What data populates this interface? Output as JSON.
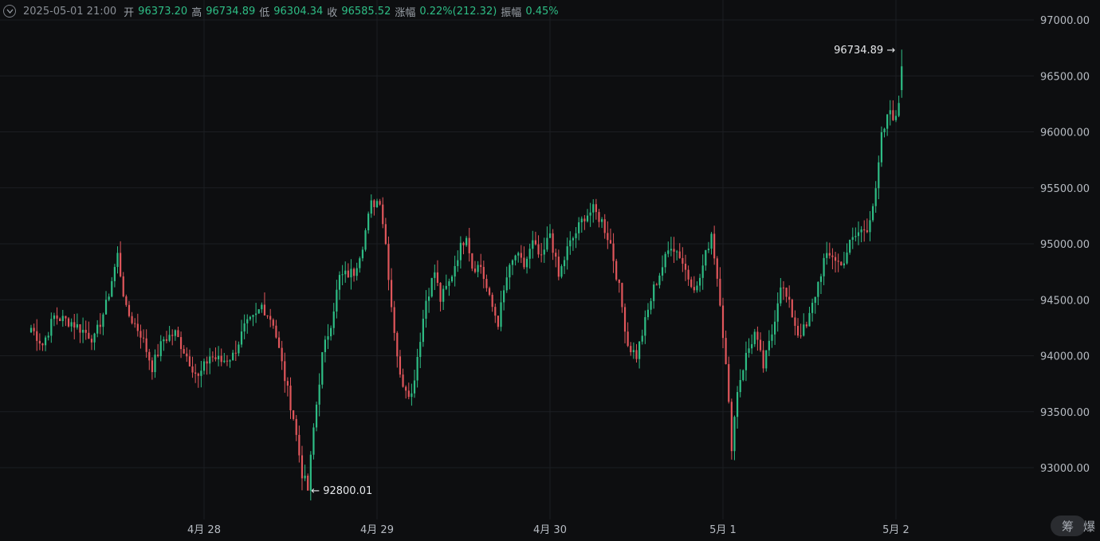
{
  "info_bar": {
    "datetime": "2025-05-01 21:00",
    "open_label": "开",
    "open_value": "96373.20",
    "high_label": "高",
    "high_value": "96734.89",
    "low_label": "低",
    "low_value": "96304.34",
    "close_label": "收",
    "close_value": "96585.52",
    "change_label": "涨幅",
    "change_value": "0.22%(212.32)",
    "amplitude_label": "振幅",
    "amplitude_value": "0.45%"
  },
  "colors": {
    "background": "#0d0e10",
    "up": "#2ebd85",
    "down": "#e0565b",
    "grid": "#1c1e22",
    "axis_text": "#b7bcc3"
  },
  "icons": {
    "collapse": "chevron-down-icon"
  },
  "corner_badge": {
    "chars": [
      "筹",
      "爆"
    ]
  },
  "chart_data": {
    "type": "candlestick",
    "y_ticks": [
      93000,
      93500,
      94000,
      94500,
      95000,
      95500,
      96000,
      96500,
      97000
    ],
    "y_tick_labels": [
      "93000.00",
      "93500.00",
      "94000.00",
      "94500.00",
      "95000.00",
      "95500.00",
      "96000.00",
      "96500.00",
      "97000.00"
    ],
    "x_ticks": [
      {
        "label": "4月 28",
        "candle_index": 60
      },
      {
        "label": "4月 29",
        "candle_index": 120
      },
      {
        "label": "4月 30",
        "candle_index": 180
      },
      {
        "label": "5月 1",
        "candle_index": 240
      },
      {
        "label": "5月 2",
        "candle_index": 300
      }
    ],
    "candles_per_day": 60,
    "annotations": {
      "max_label": "96734.89",
      "min_label": "92800.01"
    },
    "waypoints": [
      [
        0,
        94250
      ],
      [
        4,
        94100
      ],
      [
        8,
        94350
      ],
      [
        14,
        94300
      ],
      [
        22,
        94150
      ],
      [
        26,
        94450
      ],
      [
        30,
        94900
      ],
      [
        33,
        94400
      ],
      [
        38,
        94200
      ],
      [
        42,
        93900
      ],
      [
        46,
        94150
      ],
      [
        50,
        94200
      ],
      [
        54,
        94000
      ],
      [
        58,
        93800
      ],
      [
        62,
        94000
      ],
      [
        66,
        93950
      ],
      [
        70,
        94000
      ],
      [
        74,
        94250
      ],
      [
        78,
        94350
      ],
      [
        80,
        94450
      ],
      [
        84,
        94300
      ],
      [
        88,
        93800
      ],
      [
        91,
        93450
      ],
      [
        94,
        92950
      ],
      [
        96,
        92800
      ],
      [
        98,
        93350
      ],
      [
        101,
        94000
      ],
      [
        104,
        94300
      ],
      [
        107,
        94700
      ],
      [
        112,
        94750
      ],
      [
        115,
        95000
      ],
      [
        118,
        95350
      ],
      [
        121,
        95400
      ],
      [
        123,
        95000
      ],
      [
        125,
        94450
      ],
      [
        128,
        93800
      ],
      [
        132,
        93650
      ],
      [
        134,
        94000
      ],
      [
        137,
        94500
      ],
      [
        140,
        94750
      ],
      [
        142,
        94500
      ],
      [
        145,
        94650
      ],
      [
        148,
        94900
      ],
      [
        151,
        95100
      ],
      [
        153,
        94800
      ],
      [
        156,
        94800
      ],
      [
        159,
        94500
      ],
      [
        162,
        94300
      ],
      [
        165,
        94700
      ],
      [
        168,
        94900
      ],
      [
        171,
        94800
      ],
      [
        174,
        95000
      ],
      [
        177,
        94850
      ],
      [
        180,
        95100
      ],
      [
        183,
        94700
      ],
      [
        186,
        94950
      ],
      [
        189,
        95100
      ],
      [
        192,
        95250
      ],
      [
        195,
        95300
      ],
      [
        198,
        95200
      ],
      [
        201,
        95000
      ],
      [
        204,
        94600
      ],
      [
        207,
        94100
      ],
      [
        210,
        94000
      ],
      [
        213,
        94300
      ],
      [
        216,
        94600
      ],
      [
        219,
        94800
      ],
      [
        222,
        95000
      ],
      [
        225,
        94900
      ],
      [
        228,
        94700
      ],
      [
        231,
        94600
      ],
      [
        234,
        94900
      ],
      [
        236,
        95100
      ],
      [
        239,
        94500
      ],
      [
        241,
        93900
      ],
      [
        243,
        93200
      ],
      [
        245,
        93700
      ],
      [
        248,
        94000
      ],
      [
        251,
        94200
      ],
      [
        254,
        93900
      ],
      [
        257,
        94200
      ],
      [
        260,
        94650
      ],
      [
        263,
        94450
      ],
      [
        266,
        94200
      ],
      [
        269,
        94250
      ],
      [
        272,
        94550
      ],
      [
        275,
        94850
      ],
      [
        278,
        94900
      ],
      [
        281,
        94800
      ],
      [
        284,
        95000
      ],
      [
        287,
        95100
      ],
      [
        290,
        95150
      ],
      [
        293,
        95450
      ],
      [
        295,
        95950
      ],
      [
        298,
        96200
      ],
      [
        300,
        96100
      ],
      [
        302,
        96450
      ]
    ],
    "last_candle": {
      "open": 96373.2,
      "high": 96734.89,
      "low": 96304.34,
      "close": 96585.52
    }
  }
}
